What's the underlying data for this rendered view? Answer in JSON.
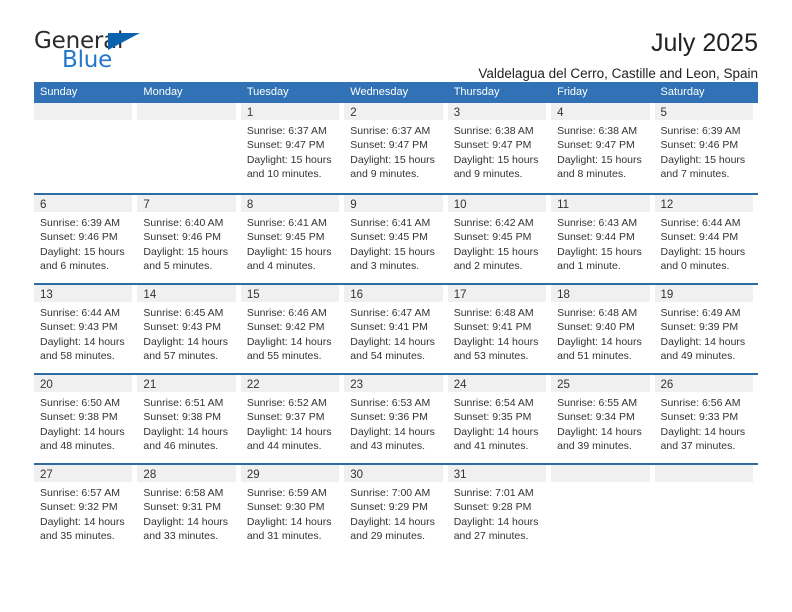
{
  "brand": {
    "name_top": "General",
    "name_bottom": "Blue",
    "triangle_color": "#0b63b0",
    "blue_color": "#2277cc"
  },
  "header": {
    "title": "July 2025",
    "subtitle": "Valdelagua del Cerro, Castille and Leon, Spain"
  },
  "theme": {
    "header_blue": "#3072b5",
    "week_divider": "#2e6da4",
    "daynum_band": "#f0f0f0",
    "text": "#333333"
  },
  "weekdays": [
    "Sunday",
    "Monday",
    "Tuesday",
    "Wednesday",
    "Thursday",
    "Friday",
    "Saturday"
  ],
  "weeks": [
    [
      {
        "day": "",
        "sunrise": "",
        "sunset": "",
        "daylight_line1": "",
        "daylight_line2": ""
      },
      {
        "day": "",
        "sunrise": "",
        "sunset": "",
        "daylight_line1": "",
        "daylight_line2": ""
      },
      {
        "day": "1",
        "sunrise": "Sunrise: 6:37 AM",
        "sunset": "Sunset: 9:47 PM",
        "daylight_line1": "Daylight: 15 hours",
        "daylight_line2": "and 10 minutes."
      },
      {
        "day": "2",
        "sunrise": "Sunrise: 6:37 AM",
        "sunset": "Sunset: 9:47 PM",
        "daylight_line1": "Daylight: 15 hours",
        "daylight_line2": "and 9 minutes."
      },
      {
        "day": "3",
        "sunrise": "Sunrise: 6:38 AM",
        "sunset": "Sunset: 9:47 PM",
        "daylight_line1": "Daylight: 15 hours",
        "daylight_line2": "and 9 minutes."
      },
      {
        "day": "4",
        "sunrise": "Sunrise: 6:38 AM",
        "sunset": "Sunset: 9:47 PM",
        "daylight_line1": "Daylight: 15 hours",
        "daylight_line2": "and 8 minutes."
      },
      {
        "day": "5",
        "sunrise": "Sunrise: 6:39 AM",
        "sunset": "Sunset: 9:46 PM",
        "daylight_line1": "Daylight: 15 hours",
        "daylight_line2": "and 7 minutes."
      }
    ],
    [
      {
        "day": "6",
        "sunrise": "Sunrise: 6:39 AM",
        "sunset": "Sunset: 9:46 PM",
        "daylight_line1": "Daylight: 15 hours",
        "daylight_line2": "and 6 minutes."
      },
      {
        "day": "7",
        "sunrise": "Sunrise: 6:40 AM",
        "sunset": "Sunset: 9:46 PM",
        "daylight_line1": "Daylight: 15 hours",
        "daylight_line2": "and 5 minutes."
      },
      {
        "day": "8",
        "sunrise": "Sunrise: 6:41 AM",
        "sunset": "Sunset: 9:45 PM",
        "daylight_line1": "Daylight: 15 hours",
        "daylight_line2": "and 4 minutes."
      },
      {
        "day": "9",
        "sunrise": "Sunrise: 6:41 AM",
        "sunset": "Sunset: 9:45 PM",
        "daylight_line1": "Daylight: 15 hours",
        "daylight_line2": "and 3 minutes."
      },
      {
        "day": "10",
        "sunrise": "Sunrise: 6:42 AM",
        "sunset": "Sunset: 9:45 PM",
        "daylight_line1": "Daylight: 15 hours",
        "daylight_line2": "and 2 minutes."
      },
      {
        "day": "11",
        "sunrise": "Sunrise: 6:43 AM",
        "sunset": "Sunset: 9:44 PM",
        "daylight_line1": "Daylight: 15 hours",
        "daylight_line2": "and 1 minute."
      },
      {
        "day": "12",
        "sunrise": "Sunrise: 6:44 AM",
        "sunset": "Sunset: 9:44 PM",
        "daylight_line1": "Daylight: 15 hours",
        "daylight_line2": "and 0 minutes."
      }
    ],
    [
      {
        "day": "13",
        "sunrise": "Sunrise: 6:44 AM",
        "sunset": "Sunset: 9:43 PM",
        "daylight_line1": "Daylight: 14 hours",
        "daylight_line2": "and 58 minutes."
      },
      {
        "day": "14",
        "sunrise": "Sunrise: 6:45 AM",
        "sunset": "Sunset: 9:43 PM",
        "daylight_line1": "Daylight: 14 hours",
        "daylight_line2": "and 57 minutes."
      },
      {
        "day": "15",
        "sunrise": "Sunrise: 6:46 AM",
        "sunset": "Sunset: 9:42 PM",
        "daylight_line1": "Daylight: 14 hours",
        "daylight_line2": "and 55 minutes."
      },
      {
        "day": "16",
        "sunrise": "Sunrise: 6:47 AM",
        "sunset": "Sunset: 9:41 PM",
        "daylight_line1": "Daylight: 14 hours",
        "daylight_line2": "and 54 minutes."
      },
      {
        "day": "17",
        "sunrise": "Sunrise: 6:48 AM",
        "sunset": "Sunset: 9:41 PM",
        "daylight_line1": "Daylight: 14 hours",
        "daylight_line2": "and 53 minutes."
      },
      {
        "day": "18",
        "sunrise": "Sunrise: 6:48 AM",
        "sunset": "Sunset: 9:40 PM",
        "daylight_line1": "Daylight: 14 hours",
        "daylight_line2": "and 51 minutes."
      },
      {
        "day": "19",
        "sunrise": "Sunrise: 6:49 AM",
        "sunset": "Sunset: 9:39 PM",
        "daylight_line1": "Daylight: 14 hours",
        "daylight_line2": "and 49 minutes."
      }
    ],
    [
      {
        "day": "20",
        "sunrise": "Sunrise: 6:50 AM",
        "sunset": "Sunset: 9:38 PM",
        "daylight_line1": "Daylight: 14 hours",
        "daylight_line2": "and 48 minutes."
      },
      {
        "day": "21",
        "sunrise": "Sunrise: 6:51 AM",
        "sunset": "Sunset: 9:38 PM",
        "daylight_line1": "Daylight: 14 hours",
        "daylight_line2": "and 46 minutes."
      },
      {
        "day": "22",
        "sunrise": "Sunrise: 6:52 AM",
        "sunset": "Sunset: 9:37 PM",
        "daylight_line1": "Daylight: 14 hours",
        "daylight_line2": "and 44 minutes."
      },
      {
        "day": "23",
        "sunrise": "Sunrise: 6:53 AM",
        "sunset": "Sunset: 9:36 PM",
        "daylight_line1": "Daylight: 14 hours",
        "daylight_line2": "and 43 minutes."
      },
      {
        "day": "24",
        "sunrise": "Sunrise: 6:54 AM",
        "sunset": "Sunset: 9:35 PM",
        "daylight_line1": "Daylight: 14 hours",
        "daylight_line2": "and 41 minutes."
      },
      {
        "day": "25",
        "sunrise": "Sunrise: 6:55 AM",
        "sunset": "Sunset: 9:34 PM",
        "daylight_line1": "Daylight: 14 hours",
        "daylight_line2": "and 39 minutes."
      },
      {
        "day": "26",
        "sunrise": "Sunrise: 6:56 AM",
        "sunset": "Sunset: 9:33 PM",
        "daylight_line1": "Daylight: 14 hours",
        "daylight_line2": "and 37 minutes."
      }
    ],
    [
      {
        "day": "27",
        "sunrise": "Sunrise: 6:57 AM",
        "sunset": "Sunset: 9:32 PM",
        "daylight_line1": "Daylight: 14 hours",
        "daylight_line2": "and 35 minutes."
      },
      {
        "day": "28",
        "sunrise": "Sunrise: 6:58 AM",
        "sunset": "Sunset: 9:31 PM",
        "daylight_line1": "Daylight: 14 hours",
        "daylight_line2": "and 33 minutes."
      },
      {
        "day": "29",
        "sunrise": "Sunrise: 6:59 AM",
        "sunset": "Sunset: 9:30 PM",
        "daylight_line1": "Daylight: 14 hours",
        "daylight_line2": "and 31 minutes."
      },
      {
        "day": "30",
        "sunrise": "Sunrise: 7:00 AM",
        "sunset": "Sunset: 9:29 PM",
        "daylight_line1": "Daylight: 14 hours",
        "daylight_line2": "and 29 minutes."
      },
      {
        "day": "31",
        "sunrise": "Sunrise: 7:01 AM",
        "sunset": "Sunset: 9:28 PM",
        "daylight_line1": "Daylight: 14 hours",
        "daylight_line2": "and 27 minutes."
      },
      {
        "day": "",
        "sunrise": "",
        "sunset": "",
        "daylight_line1": "",
        "daylight_line2": ""
      },
      {
        "day": "",
        "sunrise": "",
        "sunset": "",
        "daylight_line1": "",
        "daylight_line2": ""
      }
    ]
  ]
}
